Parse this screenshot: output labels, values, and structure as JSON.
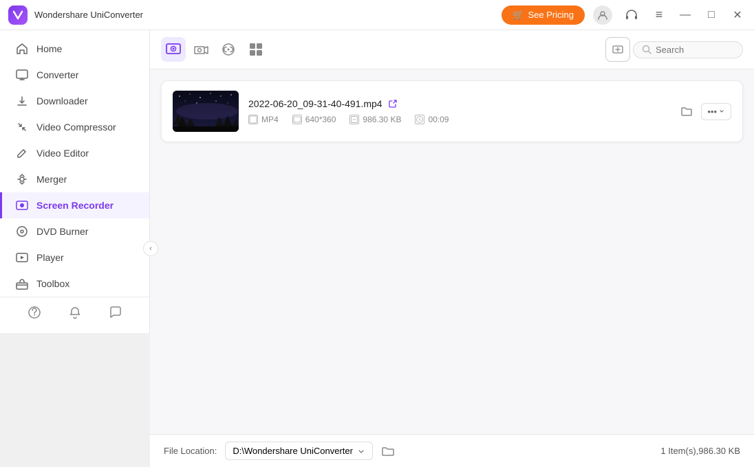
{
  "titlebar": {
    "app_name": "Wondershare UniConverter",
    "pricing_label": "See Pricing",
    "pricing_icon": "🛒"
  },
  "sidebar": {
    "items": [
      {
        "id": "home",
        "label": "Home",
        "icon": "home"
      },
      {
        "id": "converter",
        "label": "Converter",
        "icon": "converter"
      },
      {
        "id": "downloader",
        "label": "Downloader",
        "icon": "downloader"
      },
      {
        "id": "video-compressor",
        "label": "Video Compressor",
        "icon": "compress"
      },
      {
        "id": "video-editor",
        "label": "Video Editor",
        "icon": "edit"
      },
      {
        "id": "merger",
        "label": "Merger",
        "icon": "merge"
      },
      {
        "id": "screen-recorder",
        "label": "Screen Recorder",
        "icon": "record",
        "active": true
      },
      {
        "id": "dvd-burner",
        "label": "DVD Burner",
        "icon": "dvd"
      },
      {
        "id": "player",
        "label": "Player",
        "icon": "player"
      },
      {
        "id": "toolbox",
        "label": "Toolbox",
        "icon": "toolbox"
      }
    ],
    "bottom_icons": [
      "help",
      "bell",
      "chat"
    ]
  },
  "tabs": [
    {
      "id": "screen",
      "label": "Screen Recording",
      "active": true
    },
    {
      "id": "camera",
      "label": "Camera",
      "active": false
    },
    {
      "id": "audio",
      "label": "Audio",
      "active": false
    },
    {
      "id": "multi",
      "label": "Multi",
      "active": false
    }
  ],
  "search": {
    "placeholder": "Search"
  },
  "file": {
    "name": "2022-06-20_09-31-40-491.mp4",
    "format": "MP4",
    "resolution": "640*360",
    "size": "986.30 KB",
    "duration": "00:09"
  },
  "bottom": {
    "file_location_label": "File Location:",
    "location_path": "D:\\Wondershare UniConverter",
    "summary": "1 Item(s),986.30 KB"
  },
  "window_controls": {
    "minimize": "—",
    "maximize": "□",
    "close": "✕"
  }
}
